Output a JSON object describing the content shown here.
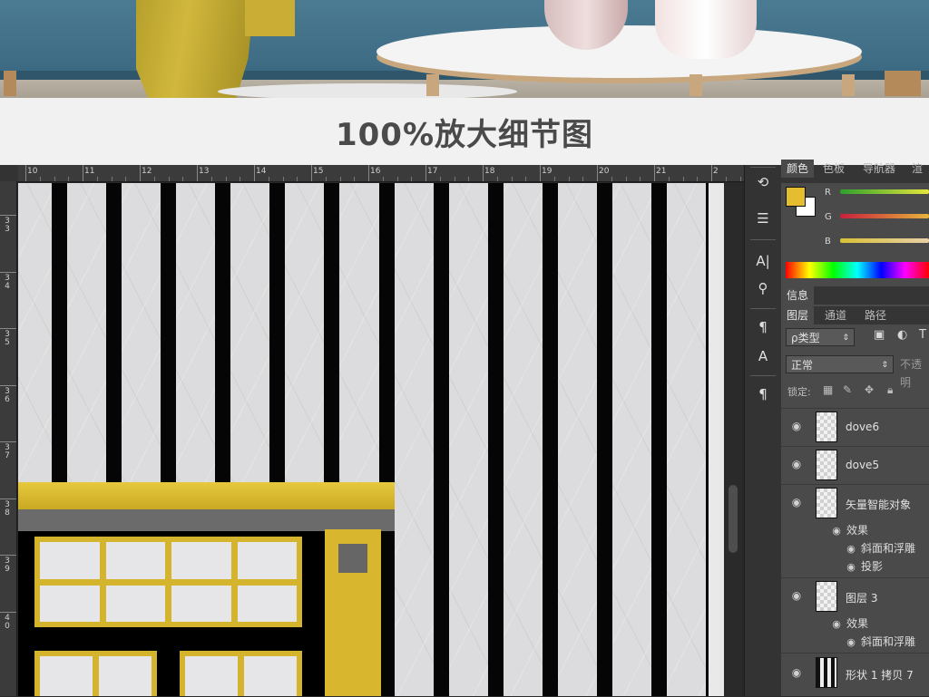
{
  "title": "100%放大细节图",
  "ruler": {
    "top": [
      "10",
      "11",
      "12",
      "13",
      "14",
      "15",
      "16",
      "17",
      "18",
      "19",
      "20",
      "21",
      "2"
    ],
    "left": [
      "3\n3",
      "3\n4",
      "3\n5",
      "3\n6",
      "3\n7",
      "3\n8",
      "3\n9",
      "4\n0"
    ]
  },
  "tools": [
    "tool-history-icon",
    "tool-clone-source-icon",
    "tool-character-icon",
    "tool-brush-presets-icon",
    "tool-paragraph-styles-icon",
    "tool-character-styles-icon",
    "tool-paragraph-icon"
  ],
  "color_panel": {
    "tabs": [
      "颜色",
      "色板",
      "导航器",
      "渲"
    ],
    "channels": [
      "R",
      "G",
      "B"
    ],
    "fg_color": "#e4be2f",
    "bg_color": "#ffffff"
  },
  "info_panel": {
    "tab": "信息"
  },
  "layers_panel": {
    "tabs": [
      "图层",
      "通道",
      "路径"
    ],
    "filter_kind": "ρ类型",
    "blend_mode": "正常",
    "opacity_label": "不透明",
    "lock_label": "锁定:",
    "layers": [
      {
        "name": "dove6"
      },
      {
        "name": "dove5"
      },
      {
        "name": "矢量智能对象",
        "effects_label": "效果",
        "effects": [
          "斜面和浮雕",
          "投影"
        ]
      },
      {
        "name": "图层 3",
        "effects_label": "效果",
        "effects": [
          "斜面和浮雕"
        ]
      },
      {
        "name": "形状 1 拷贝 7"
      }
    ]
  }
}
